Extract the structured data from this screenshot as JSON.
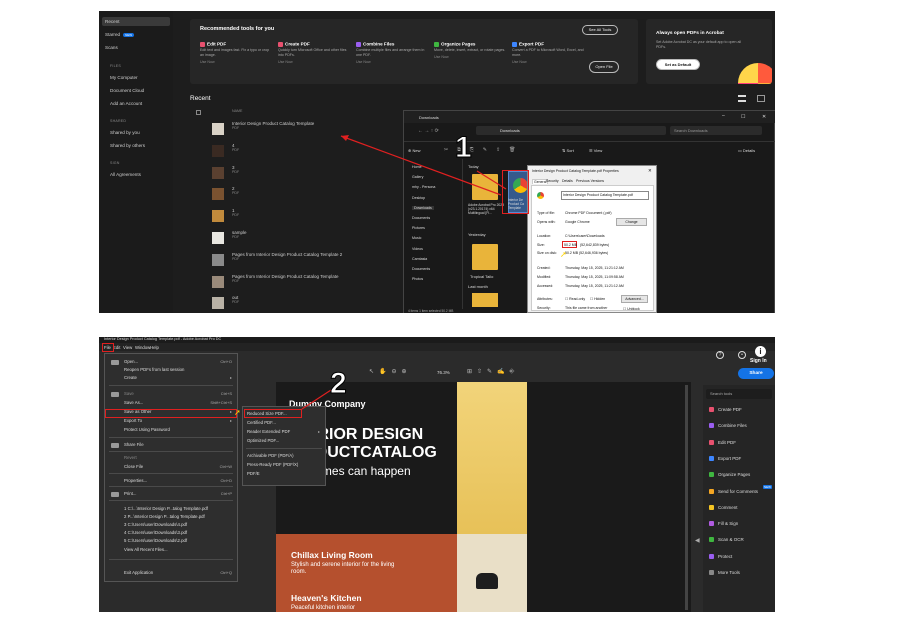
{
  "colors": {
    "accent": "#1473e6",
    "annotation": "#e02020"
  },
  "home": {
    "sidebar": {
      "items": [
        "Recent",
        "Starred",
        "Scans"
      ],
      "starred_badge": "NEW",
      "files_header": "FILES",
      "files": [
        "My Computer",
        "Document Cloud",
        "Add an Account"
      ],
      "shared_header": "SHARED",
      "shared": [
        "Shared by you",
        "Shared by others"
      ],
      "sign_header": "SIGN",
      "sign": [
        "All Agreements"
      ]
    },
    "recommended": {
      "title": "Recommended tools for you",
      "see_all": "See All Tools",
      "tools": [
        {
          "name": "Edit PDF",
          "desc": "Edit text and images fast. Fix a typo or crop an image.",
          "action": "Use Now",
          "icon": "edit-pdf-icon",
          "color": "#e8516f"
        },
        {
          "name": "Create PDF",
          "desc": "Quickly turn Microsoft Office and other files into PDFs.",
          "action": "Use Now",
          "icon": "create-pdf-icon",
          "color": "#e8516f"
        },
        {
          "name": "Combine Files",
          "desc": "Combine multiple files and arrange them in one PDF.",
          "action": "Use Now",
          "icon": "combine-files-icon",
          "color": "#9a5ef0"
        },
        {
          "name": "Organize Pages",
          "desc": "Move, delete, insert, extract, or rotate pages.",
          "action": "Use Now",
          "icon": "organize-pages-icon",
          "color": "#3fb640"
        },
        {
          "name": "Export PDF",
          "desc": "Convert a PDF to Microsoft Word, Excel, and more.",
          "action": "Use Now",
          "icon": "export-pdf-icon",
          "color": "#3d86ff"
        }
      ],
      "open_file": "Open File"
    },
    "default_card": {
      "title": "Always open PDFs in Acrobat",
      "body": "Set Adobe Acrobat DC as your default app to open all PDFs.",
      "button": "Set as Default"
    },
    "recent": {
      "title": "Recent",
      "col_name": "NAME",
      "rows": [
        {
          "name": "Interior Design Product Catalog Template",
          "type": "PDF"
        },
        {
          "name": "4",
          "type": "PDF"
        },
        {
          "name": "3",
          "type": "PDF"
        },
        {
          "name": "2",
          "type": "PDF"
        },
        {
          "name": "1",
          "type": "PDF"
        },
        {
          "name": "sample",
          "type": "PDF"
        },
        {
          "name": "Pages from Interior Design Product Catalog Template 2",
          "type": "PDF"
        },
        {
          "name": "Pages from Interior Design Product Catalog Template",
          "type": "PDF"
        },
        {
          "name": "out",
          "type": "PDF"
        }
      ]
    }
  },
  "explorer": {
    "title": "Downloads",
    "new": "New",
    "sort": "Sort",
    "view": "View",
    "details": "Details",
    "path": "Downloads",
    "search_placeholder": "Search Downloads",
    "nav": [
      "Home",
      "Gallery",
      "mhy - Persona",
      "Desktop",
      "Downloads",
      "Documents",
      "Pictures",
      "Music",
      "Videos",
      "Camtasia",
      "Documents",
      "Photos"
    ],
    "groups": [
      "Today",
      "Yesterday",
      "Last month"
    ],
    "files": [
      "Adobe Acrobat Pro 2023 (v23.1.20174) x64 Multilingual [Fi...",
      "Tropical Tailo"
    ],
    "selected_label": "Interior De Product Ca Template",
    "status": "4 items  1 item selected  50.2 MB",
    "annotation": "1"
  },
  "properties": {
    "title": "Interior Design Product Catalog Template.pdf Properties",
    "tabs": [
      "General",
      "Security",
      "Details",
      "Previous Versions"
    ],
    "filename": "Interior Design Product Catalog Template.pdf",
    "type_label": "Type of file:",
    "type_value": "Chrome PDF Document (.pdf)",
    "opens_label": "Opens with:",
    "opens_value": "Google Chrome",
    "change": "Change",
    "location_label": "Location:",
    "location_value": "C:\\Users\\user\\Downloads",
    "size_label": "Size:",
    "size_value": "50.2 MB",
    "size_bytes": "(52,642,839 bytes)",
    "disk_label": "Size on disk:",
    "disk_value": "50.2 MB (52,646,936 bytes)",
    "created_label": "Created:",
    "created_value": "Thursday, May 15, 2025, 11:21:12 AM",
    "modified_label": "Modified:",
    "modified_value": "Thursday, May 15, 2025, 11:09:58 AM",
    "accessed_label": "Accessed:",
    "accessed_value": "Thursday, May 15, 2025, 11:21:12 AM",
    "attributes_label": "Attributes:",
    "readonly": "Read-only",
    "hidden": "Hidden",
    "advanced": "Advanced...",
    "security_label": "Security:",
    "security_value": "This file came from another",
    "unblock": "Unblock"
  },
  "acrobat": {
    "title": "Interior Design Product Catalog Template.pdf - Adobe Acrobat Pro DC",
    "menubar": [
      "File",
      "Edit",
      "View",
      "Window",
      "Help"
    ],
    "sign_in": "Sign In",
    "share": "Share",
    "zoom": "76.3%",
    "file_menu": [
      {
        "label": "Open...",
        "shortcut": "Ctrl+O"
      },
      {
        "label": "Reopen PDFs from last session",
        "shortcut": ""
      },
      {
        "label": "Create",
        "shortcut": "▸"
      },
      {
        "label": "Save",
        "shortcut": "Ctrl+S"
      },
      {
        "label": "Save As...",
        "shortcut": "Shift+Ctrl+S"
      },
      {
        "label": "Save as Other",
        "shortcut": "▸"
      },
      {
        "label": "Export To",
        "shortcut": "▸"
      },
      {
        "label": "Protect Using Password",
        "shortcut": ""
      },
      {
        "label": "Share File",
        "shortcut": ""
      },
      {
        "label": "Revert",
        "shortcut": ""
      },
      {
        "label": "Close File",
        "shortcut": "Ctrl+W"
      },
      {
        "label": "Properties...",
        "shortcut": "Ctrl+D"
      },
      {
        "label": "Print...",
        "shortcut": "Ctrl+P"
      },
      {
        "label": "1 C:\\...\\Interior Design P...talog Template.pdf",
        "shortcut": ""
      },
      {
        "label": "2 P...\\Interior Design P...talog Template.pdf",
        "shortcut": ""
      },
      {
        "label": "3 C:\\Users\\user\\Downloads\\4.pdf",
        "shortcut": ""
      },
      {
        "label": "4 C:\\Users\\user\\Downloads\\3.pdf",
        "shortcut": ""
      },
      {
        "label": "5 C:\\Users\\user\\Downloads\\2.pdf",
        "shortcut": ""
      },
      {
        "label": "View All Recent Files...",
        "shortcut": ""
      },
      {
        "label": "Exit Application",
        "shortcut": "Ctrl+Q"
      }
    ],
    "submenu": [
      "Reduced Size PDF...",
      "Certified PDF...",
      "Reader Extended PDF",
      "Optimized PDF...",
      "Archivable PDF (PDF/A)",
      "Press-Ready PDF (PDF/X)",
      "PDF/E"
    ],
    "submenu_arrow": "▸",
    "annotation": "2",
    "document": {
      "company": "Dummy Company",
      "heading1": "INTERIOR DESIGN",
      "heading2": "PRODUCTCATALOG",
      "tagline": "Your homes can happen",
      "section1_title": "Chillax Living Room",
      "section1_body": "Stylish and serene interior for the living room.",
      "section2_title": "Heaven's Kitchen",
      "section2_body": "Peaceful kitchen interior"
    },
    "search_tools": "Search tools",
    "tools": [
      {
        "label": "Create PDF",
        "color": "#e8516f"
      },
      {
        "label": "Combine Files",
        "color": "#9a5ef0"
      },
      {
        "label": "Edit PDF",
        "color": "#e8516f"
      },
      {
        "label": "Export PDF",
        "color": "#3d86ff"
      },
      {
        "label": "Organize Pages",
        "color": "#3fb640"
      },
      {
        "label": "Send for Comments",
        "color": "#f5a623"
      },
      {
        "label": "Comment",
        "color": "#f5c523"
      },
      {
        "label": "Fill & Sign",
        "color": "#b05be0"
      },
      {
        "label": "Scan & OCR",
        "color": "#3fb640"
      },
      {
        "label": "Protect",
        "color": "#9a5ef0"
      },
      {
        "label": "More Tools",
        "color": "#888888"
      }
    ],
    "send_badge": "NEW"
  }
}
